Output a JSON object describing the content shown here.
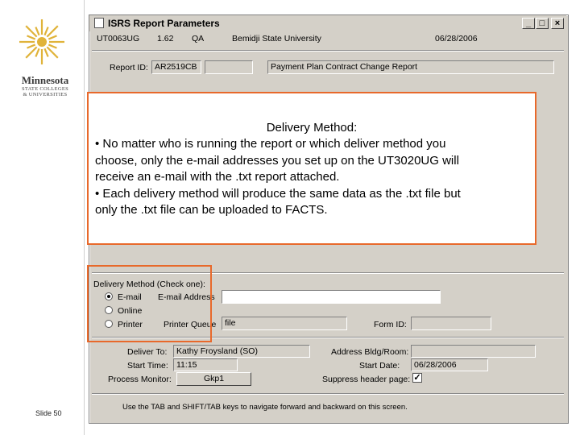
{
  "logo": {
    "name": "Minnesota",
    "subtitle_lines": [
      "STATE COLLEGES",
      "& UNIVERSITIES"
    ],
    "icon": "star-burst-icon",
    "color": "#e0b33a"
  },
  "slide_number": "Slide 50",
  "window": {
    "title": "ISRS Report Parameters",
    "buttons": {
      "minimize": "_",
      "maximize": "□",
      "close": "×"
    }
  },
  "header": {
    "report_code": "UT0063UG",
    "version": "1.62",
    "env": "QA",
    "institution": "Bemidji State University",
    "date": "06/28/2006"
  },
  "report": {
    "id_label": "Report ID:",
    "id_value": "AR2519CB",
    "name": "Payment Plan Contract Change Report"
  },
  "callout": {
    "title": "Delivery Method:",
    "lines": [
      "• No matter who is running the report or which deliver method you",
      "choose, only the e-mail addresses you set up on the UT3020UG will",
      "receive an e-mail with the .txt report attached.",
      "• Each delivery method will produce the same data as the .txt file but",
      "only the .txt file can be uploaded to FACTS."
    ],
    "border_color": "#e8692b"
  },
  "delivery": {
    "section_label": "Delivery Method (Check one):",
    "options": [
      {
        "label": "E-mail",
        "selected": true
      },
      {
        "label": "Online",
        "selected": false
      },
      {
        "label": "Printer",
        "selected": false
      }
    ],
    "email_address_label": "E-mail Address",
    "email_address_value": "",
    "printer_queue_label": "Printer Queue",
    "printer_queue_value": "file",
    "form_id_label": "Form ID:",
    "form_id_value": ""
  },
  "bottom": {
    "deliver_to_label": "Deliver To:",
    "deliver_to_value": "Kathy Froysland (SO)",
    "start_time_label": "Start Time:",
    "start_time_value": "11:15",
    "process_monitor_label": "Process Monitor:",
    "process_monitor_value": "Gkp1",
    "address_label": "Address Bldg/Room:",
    "address_value": "",
    "start_date_label": "Start Date:",
    "start_date_value": "06/28/2006",
    "suppress_label": "Suppress header page:",
    "suppress_checked": true
  },
  "hint": "Use the TAB and SHIFT/TAB keys to navigate forward and backward on this screen."
}
